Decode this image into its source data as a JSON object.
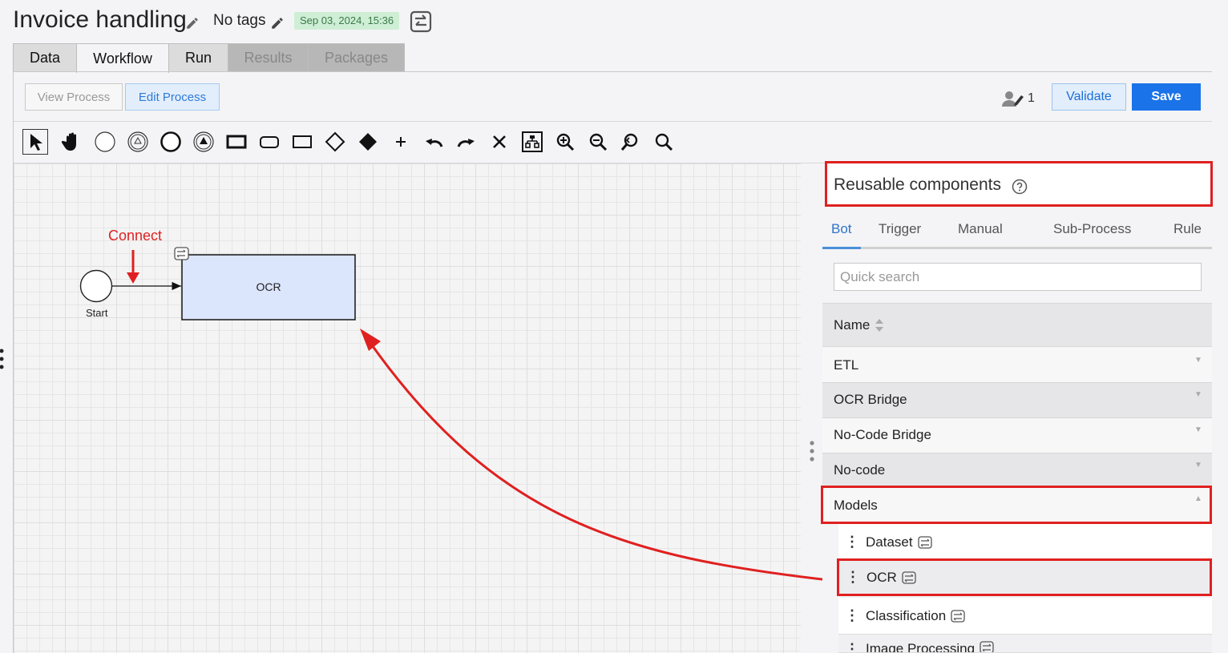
{
  "header": {
    "title": "Invoice handling",
    "tags": "No tags",
    "date": "Sep 03, 2024, 15:36"
  },
  "tabs": [
    {
      "label": "Data"
    },
    {
      "label": "Workflow"
    },
    {
      "label": "Run"
    },
    {
      "label": "Results"
    },
    {
      "label": "Packages"
    }
  ],
  "subtoolbar": {
    "view_process": "View Process",
    "edit_process": "Edit Process",
    "users_count": "1",
    "validate": "Validate",
    "save": "Save"
  },
  "tools": [
    "select-tool",
    "hand-tool",
    "start-event-tool",
    "intermediate-event-tool",
    "end-event-tool",
    "escalation-event-tool",
    "task-tool",
    "subprocess-tool",
    "pool-tool",
    "gateway-tool",
    "exclusive-gateway-tool",
    "add-tool",
    "undo-tool",
    "redo-tool",
    "delete-tool",
    "layout-tool",
    "zoom-in-tool",
    "zoom-out-tool",
    "zoom-reset-tool",
    "zoom-fit-tool"
  ],
  "diagram": {
    "start_label": "Start",
    "task_label": "OCR",
    "annotation": "Connect"
  },
  "panel": {
    "title": "Reusable components",
    "tabs": [
      "Bot",
      "Trigger",
      "Manual",
      "Sub-Process",
      "Rule"
    ],
    "search_placeholder": "Quick search",
    "column_header": "Name",
    "groups": [
      "ETL",
      "OCR Bridge",
      "No-Code Bridge",
      "No-code",
      "Models"
    ],
    "items": [
      "Dataset",
      "OCR",
      "Classification",
      "Image Processing"
    ]
  },
  "colors": {
    "highlight": "#e02020",
    "accent": "#1a73e8",
    "task_fill": "#dbe5fb",
    "date_badge": "#cfeed6"
  }
}
